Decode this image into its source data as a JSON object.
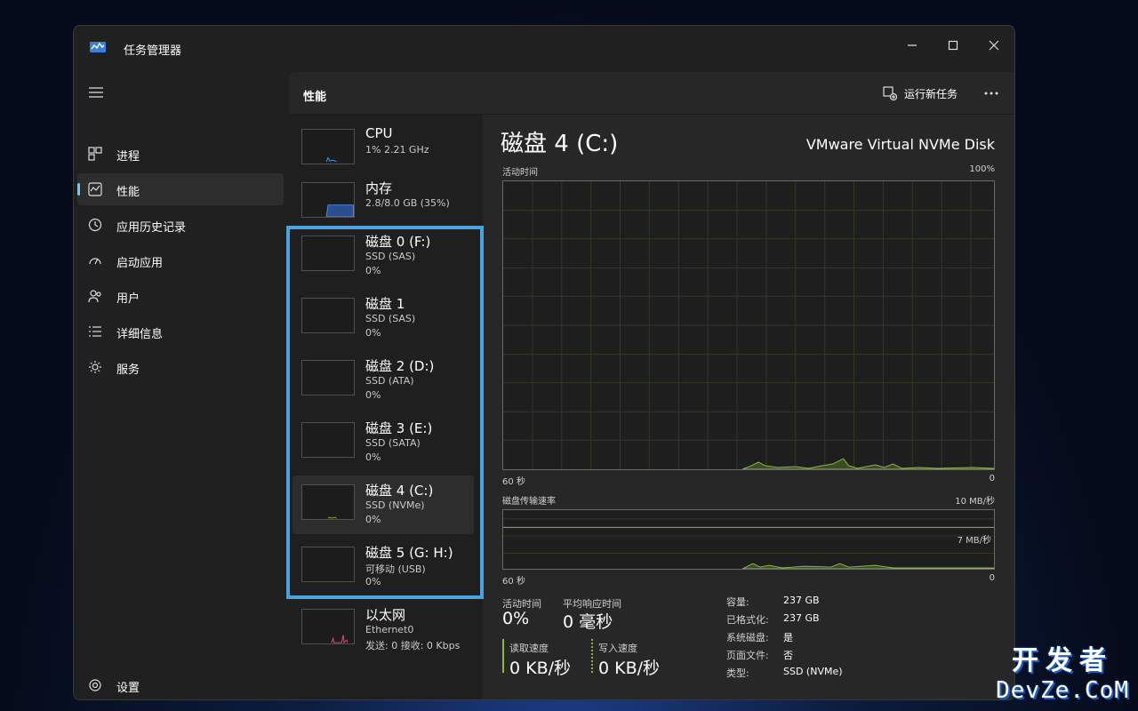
{
  "app": {
    "title": "任务管理器"
  },
  "sidebar": {
    "items": [
      {
        "label": "进程",
        "icon": "processes-icon"
      },
      {
        "label": "性能",
        "icon": "performance-icon",
        "active": true
      },
      {
        "label": "应用历史记录",
        "icon": "history-icon"
      },
      {
        "label": "启动应用",
        "icon": "startup-icon"
      },
      {
        "label": "用户",
        "icon": "users-icon"
      },
      {
        "label": "详细信息",
        "icon": "details-icon"
      },
      {
        "label": "服务",
        "icon": "services-icon"
      }
    ],
    "settings_label": "设置"
  },
  "header": {
    "title": "性能",
    "run_task": "运行新任务"
  },
  "devices": [
    {
      "name": "CPU",
      "sub": "1% 2.21 GHz",
      "val": ""
    },
    {
      "name": "内存",
      "sub": "2.8/8.0 GB (35%)",
      "val": ""
    },
    {
      "name": "磁盘 0 (F:)",
      "sub": "SSD (SAS)",
      "val": "0%"
    },
    {
      "name": "磁盘 1",
      "sub": "SSD (SAS)",
      "val": "0%"
    },
    {
      "name": "磁盘 2 (D:)",
      "sub": "SSD (ATA)",
      "val": "0%"
    },
    {
      "name": "磁盘 3 (E:)",
      "sub": "SSD (SATA)",
      "val": "0%"
    },
    {
      "name": "磁盘 4 (C:)",
      "sub": "SSD (NVMe)",
      "val": "0%",
      "active": true
    },
    {
      "name": "磁盘 5 (G: H:)",
      "sub": "可移动 (USB)",
      "val": "0%"
    },
    {
      "name": "以太网",
      "sub": "Ethernet0",
      "val": "发送: 0 接收: 0 Kbps"
    }
  ],
  "detail": {
    "title": "磁盘 4 (C:)",
    "model": "VMware Virtual NVMe Disk",
    "chart1": {
      "label": "活动时间",
      "max": "100%",
      "x_left": "60 秒",
      "x_right": "0"
    },
    "chart2": {
      "label": "磁盘传输速率",
      "max": "10 MB/秒",
      "mid": "7 MB/秒",
      "x_left": "60 秒",
      "x_right": "0"
    },
    "stats": {
      "active_label": "活动时间",
      "active_val": "0%",
      "resp_label": "平均响应时间",
      "resp_val": "0 毫秒",
      "read_label": "读取速度",
      "read_val": "0 KB/秒",
      "write_label": "写入速度",
      "write_val": "0 KB/秒"
    },
    "props": [
      {
        "k": "容量:",
        "v": "237 GB"
      },
      {
        "k": "已格式化:",
        "v": "237 GB"
      },
      {
        "k": "系统磁盘:",
        "v": "是"
      },
      {
        "k": "页面文件:",
        "v": "否"
      },
      {
        "k": "类型:",
        "v": "SSD (NVMe)"
      }
    ]
  },
  "watermark": {
    "top": "开发者",
    "bottom": "DevZe.CoM"
  },
  "colors": {
    "accent": "#60cdff",
    "highlight": "#4aa3df",
    "disk_line": "#8bb640"
  }
}
